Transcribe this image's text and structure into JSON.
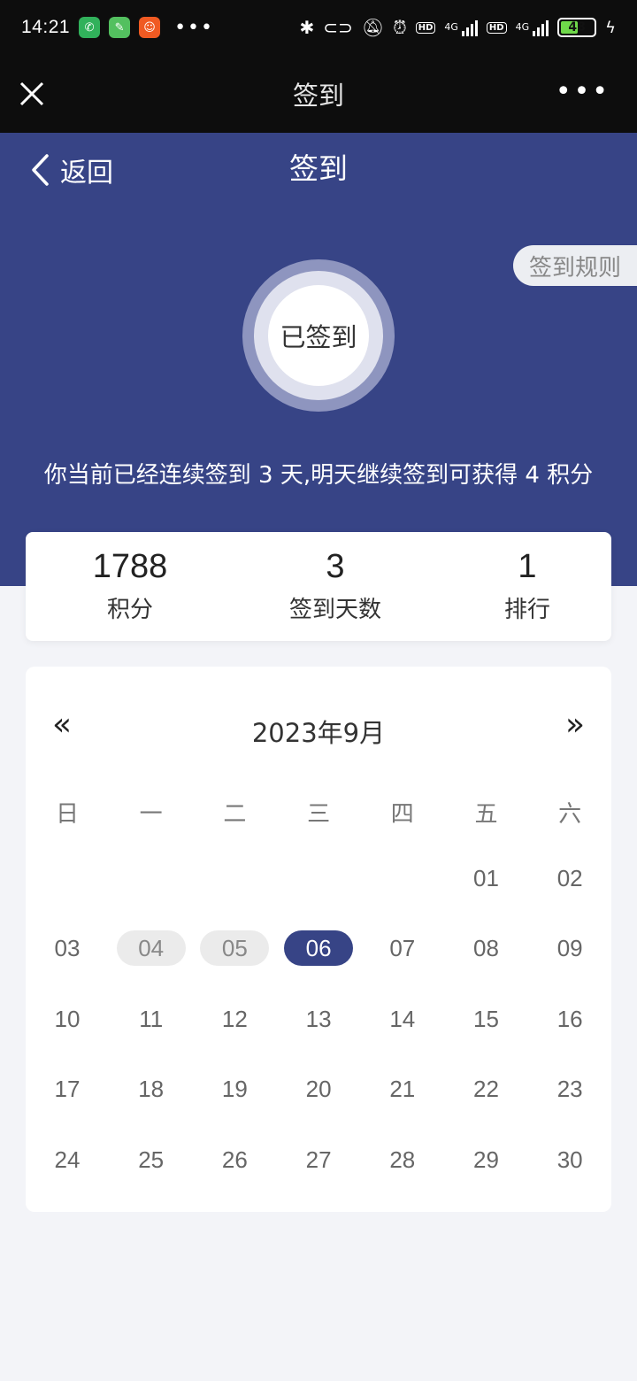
{
  "status_bar": {
    "time": "14:21",
    "battery": "48",
    "network": "4G",
    "hd": "HD"
  },
  "webview": {
    "title": "签到"
  },
  "header": {
    "back_label": "返回",
    "title": "签到",
    "rules_label": "签到规则"
  },
  "checkin": {
    "button_label": "已签到",
    "message": "你当前已经连续签到 3 天,明天继续签到可获得 4 积分"
  },
  "stats": [
    {
      "value": "1788",
      "label": "积分"
    },
    {
      "value": "3",
      "label": "签到天数"
    },
    {
      "value": "1",
      "label": "排行"
    }
  ],
  "calendar": {
    "prev": "«",
    "next": "»",
    "month_label": "2023年9月",
    "weekdays": [
      "日",
      "一",
      "二",
      "三",
      "四",
      "五",
      "六"
    ],
    "first_weekday_index": 5,
    "days": [
      "01",
      "02",
      "03",
      "04",
      "05",
      "06",
      "07",
      "08",
      "09",
      "10",
      "11",
      "12",
      "13",
      "14",
      "15",
      "16",
      "17",
      "18",
      "19",
      "20",
      "21",
      "22",
      "23",
      "24",
      "25",
      "26",
      "27",
      "28",
      "29",
      "30"
    ],
    "signed_days": [
      "04",
      "05"
    ],
    "today": "06"
  },
  "colors": {
    "primary": "#374486",
    "background": "#f3f4f8",
    "dark_bar": "#0d0d0d"
  }
}
